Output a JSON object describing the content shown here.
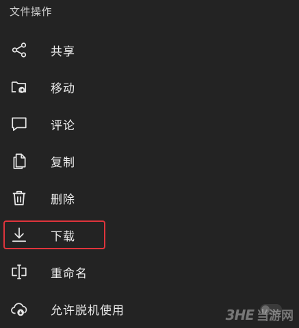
{
  "section": {
    "title": "文件操作"
  },
  "menu": {
    "items": [
      {
        "label": "共享",
        "icon": "share-icon"
      },
      {
        "label": "移动",
        "icon": "folder-move-icon"
      },
      {
        "label": "评论",
        "icon": "comment-icon"
      },
      {
        "label": "复制",
        "icon": "copy-icon"
      },
      {
        "label": "删除",
        "icon": "trash-icon"
      },
      {
        "label": "下载",
        "icon": "download-icon"
      },
      {
        "label": "重命名",
        "icon": "rename-icon"
      },
      {
        "label": "允许脱机使用",
        "icon": "cloud-download-icon"
      }
    ]
  },
  "highlight": {
    "color": "#e0343c",
    "target": "下载"
  },
  "watermark": {
    "logo": "3HE",
    "text": "当游网"
  },
  "colors": {
    "background": "#232323",
    "text": "#ececec",
    "icon": "#e6e6e6"
  }
}
